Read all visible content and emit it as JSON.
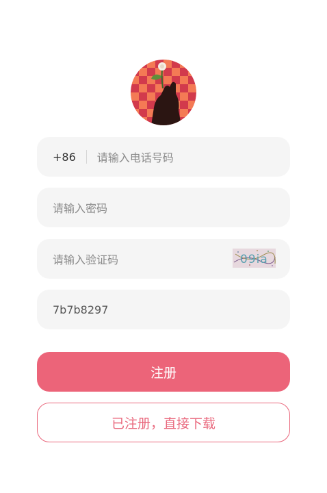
{
  "theme": {
    "accent": "#ec6479",
    "field_bg": "#f5f5f5"
  },
  "avatar": {
    "icon": "rose-in-hand-avatar"
  },
  "form": {
    "phone": {
      "country_code": "+86",
      "placeholder": "请输入电话号码"
    },
    "password": {
      "placeholder": "请输入密码"
    },
    "captcha": {
      "placeholder": "请输入验证码",
      "image_text": "09ia"
    },
    "invite_code": {
      "value": "7b7b8297"
    }
  },
  "buttons": {
    "register": "注册",
    "already_registered": "已注册，直接下载"
  }
}
